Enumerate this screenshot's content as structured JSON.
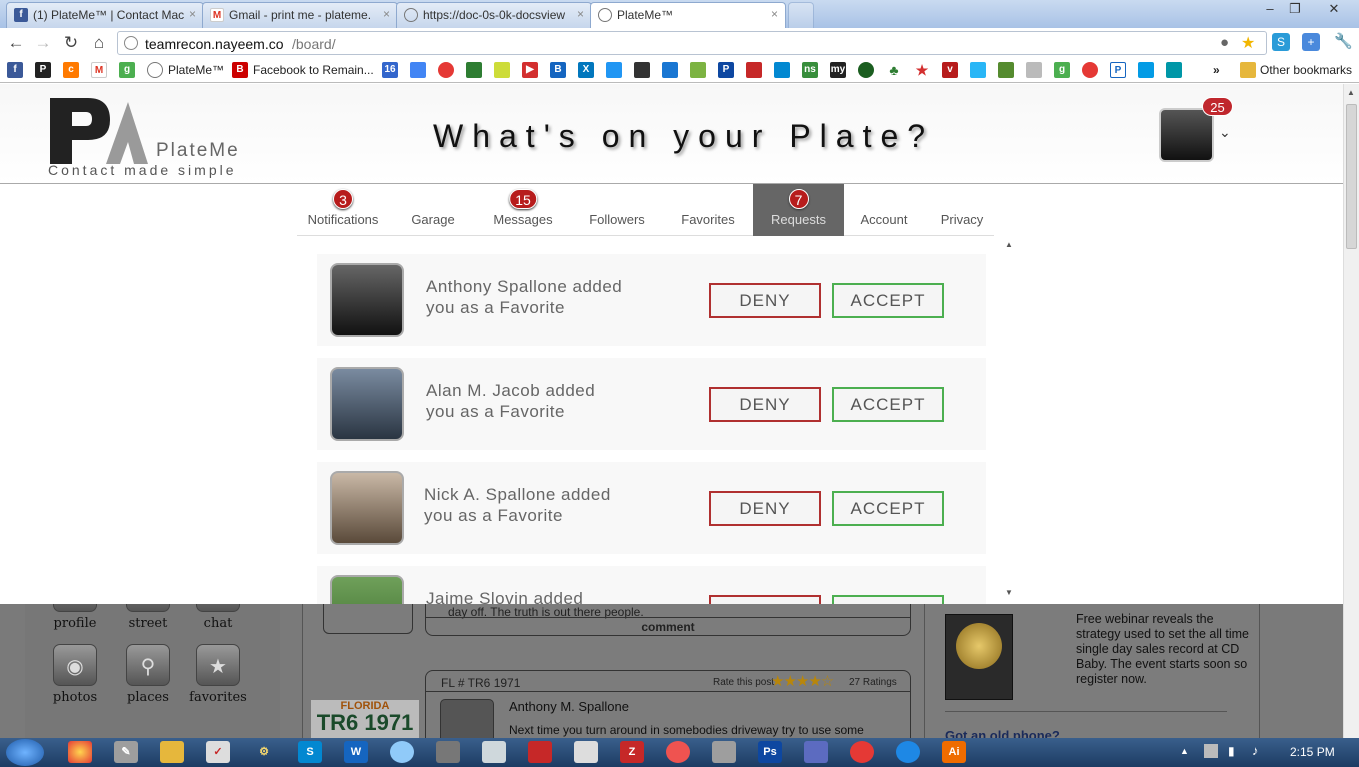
{
  "browser": {
    "tabs": [
      {
        "title": "(1) PlateMe™ | Contact Mac",
        "icon": "facebook-icon"
      },
      {
        "title": "Gmail - print me - plateme.",
        "icon": "gmail-icon"
      },
      {
        "title": "https://doc-0s-0k-docsview",
        "icon": "globe-icon"
      },
      {
        "title": "PlateMe™",
        "icon": "globe-icon"
      }
    ],
    "url_host": "teamrecon.nayeem.co",
    "url_path": "/board/",
    "bookmarks": [
      {
        "label": "PlateMe™"
      },
      {
        "label": "Facebook to Remain..."
      }
    ],
    "other_bookmarks": "Other bookmarks"
  },
  "site": {
    "logo_name": "PlateMe",
    "logo_tag": "Contact made simple",
    "headline": "What's on your Plate?",
    "user_badge": "25"
  },
  "menu": [
    {
      "label": "Notifications",
      "badge": "3"
    },
    {
      "label": "Garage",
      "badge": ""
    },
    {
      "label": "Messages",
      "badge": "15"
    },
    {
      "label": "Followers",
      "badge": ""
    },
    {
      "label": "Favorites",
      "badge": ""
    },
    {
      "label": "Requests",
      "badge": "7"
    },
    {
      "label": "Account",
      "badge": ""
    },
    {
      "label": "Privacy",
      "badge": ""
    }
  ],
  "requests": [
    {
      "name_line1": "Anthony Spallone added",
      "name_line2": "you as a Favorite"
    },
    {
      "name_line1": "Alan M. Jacob added",
      "name_line2": "you as a Favorite"
    },
    {
      "name_line1": "Nick A. Spallone added",
      "name_line2": "you as a Favorite"
    },
    {
      "name_line1": "Jaime Slovin added",
      "name_line2": ""
    }
  ],
  "deny_label": "DENY",
  "accept_label": "ACCEPT",
  "background": {
    "apps": [
      "profile",
      "street",
      "chat",
      "photos",
      "places",
      "favorites"
    ],
    "post_snippet": "day off. The truth is out there people.",
    "comment_label": "comment",
    "post_plate": "FL # TR6 1971",
    "rate_label": "Rate this post",
    "ratings": "27 Ratings",
    "author": "Anthony M. Spallone",
    "post_text": "Next time you turn around in somebodies driveway try to use some",
    "plate_state": "FLORIDA",
    "plate_number": "TR6 1971",
    "ad_text": "Free webinar reveals the strategy used to set the all time single day sales record at CD Baby. The event starts soon so register now.",
    "ad2_title": "Got an old phone?"
  },
  "taskbar": {
    "time": "2:15 PM"
  }
}
